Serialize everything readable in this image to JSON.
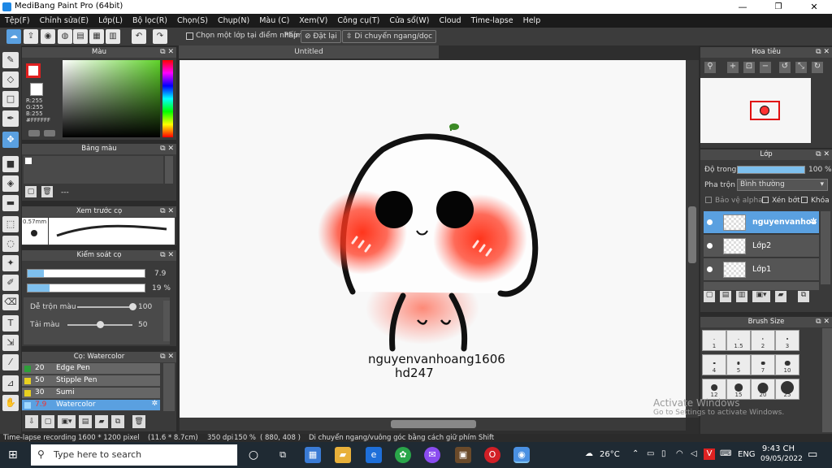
{
  "window": {
    "title": "MediBang Paint Pro (64bit)",
    "min": "—",
    "max": "❐",
    "close": "✕"
  },
  "menu": [
    "Tệp(F)",
    "Chỉnh sửa(E)",
    "Lớp(L)",
    "Bộ lọc(R)",
    "Chọn(S)",
    "Chụp(N)",
    "Màu (C)",
    "Xem(V)",
    "Công cụ(T)",
    "Cửa sổ(W)",
    "Cloud",
    "Time-lapse",
    "Help"
  ],
  "toolbar": {
    "select_one_layer": "Chọn một lớp tại điểm nhấp",
    "keys_label": "Phím",
    "reset": "Đặt lại",
    "move_h_v": "Di chuyển ngang/dọc"
  },
  "canvas": {
    "tab": "Untitled",
    "signature_line1": "nguyenvanhoang1606",
    "signature_line2": "hd247"
  },
  "color_panel": {
    "title": "Màu",
    "r": "R:255",
    "g": "G:255",
    "b": "B:255",
    "hex": "#FFFFFF"
  },
  "palette_panel": {
    "title": "Bảng màu",
    "dash": "---"
  },
  "preview_panel": {
    "title": "Xem trước cọ",
    "size": "0.57mm"
  },
  "brush_control": {
    "title": "Kiểm soát cọ",
    "size_value": "7.9",
    "size_fraction": 0.14,
    "opacity_value": "19 %",
    "opacity_fraction": 0.19,
    "blend_label": "Dễ trộn màu",
    "blend_value": "100",
    "blend_fraction": 1.0,
    "amount_label": "Tải màu",
    "amount_value": "50",
    "amount_fraction": 0.5
  },
  "brush_list": {
    "title": "Cọ: Watercolor",
    "items": [
      {
        "size": "20",
        "name": "Edge Pen",
        "color": "#2e9e3a"
      },
      {
        "size": "50",
        "name": "Stipple Pen",
        "color": "#e8d020"
      },
      {
        "size": "30",
        "name": "Sumi",
        "color": "#e8d020"
      },
      {
        "size": "7.9",
        "name": "Watercolor",
        "color": "#9fd8ff"
      }
    ]
  },
  "navigator": {
    "title": "Hoa tiêu"
  },
  "layers": {
    "title": "Lớp",
    "opacity_label": "Độ trong",
    "opacity_value": "100 %",
    "opacity_fraction": 1.0,
    "blend_label": "Pha trộn",
    "blend_value": "Bình thường",
    "protect_alpha": "Bảo vệ alpha",
    "clipping": "Xén bớt",
    "lock": "Khóa",
    "items": [
      {
        "name": "nguyenvanhoa"
      },
      {
        "name": "Lớp2"
      },
      {
        "name": "Lớp1"
      }
    ]
  },
  "brush_size": {
    "title": "Brush Size",
    "rows": [
      [
        "1",
        "1.5",
        "2",
        "3"
      ],
      [
        "4",
        "5",
        "7",
        "10"
      ],
      [
        "12",
        "15",
        "20",
        "25"
      ]
    ]
  },
  "watermark": {
    "line1": "Activate Windows",
    "line2": "Go to Settings to activate Windows."
  },
  "status": {
    "recording": "Time-lapse recording",
    "size": "1600 * 1200 pixel",
    "physical": "(11.6 * 8.7cm)",
    "dpi": "350 dpi",
    "zoom": "150 %",
    "coords": "( 880, 408 )",
    "hint": "Di chuyển ngang/vuông góc bằng cách giữ phím Shift"
  },
  "taskbar": {
    "search_placeholder": "Type here to search",
    "weather": "26°C",
    "lang": "ENG",
    "time": "9:43 CH",
    "date": "09/05/2022"
  }
}
